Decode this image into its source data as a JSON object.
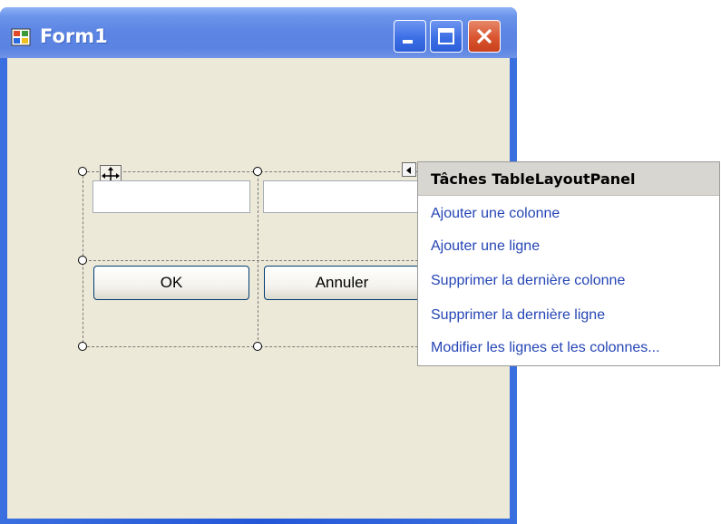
{
  "window": {
    "title": "Form1"
  },
  "form": {
    "ok_label": "OK",
    "cancel_label": "Annuler"
  },
  "tasks_panel": {
    "header": "Tâches TableLayoutPanel",
    "items": [
      "Ajouter une colonne",
      "Ajouter une ligne",
      "Supprimer la dernière colonne",
      "Supprimer la dernière ligne",
      "Modifier les lignes et les colonnes..."
    ]
  },
  "colors": {
    "title_bar": "#5c85e4",
    "client_background": "#ece9d8",
    "task_link": "#2545b5",
    "close_button": "#d9542f"
  },
  "icons": [
    "app-icon",
    "minimize-icon",
    "maximize-icon",
    "close-icon",
    "move-icon",
    "smart-tag-icon"
  ]
}
